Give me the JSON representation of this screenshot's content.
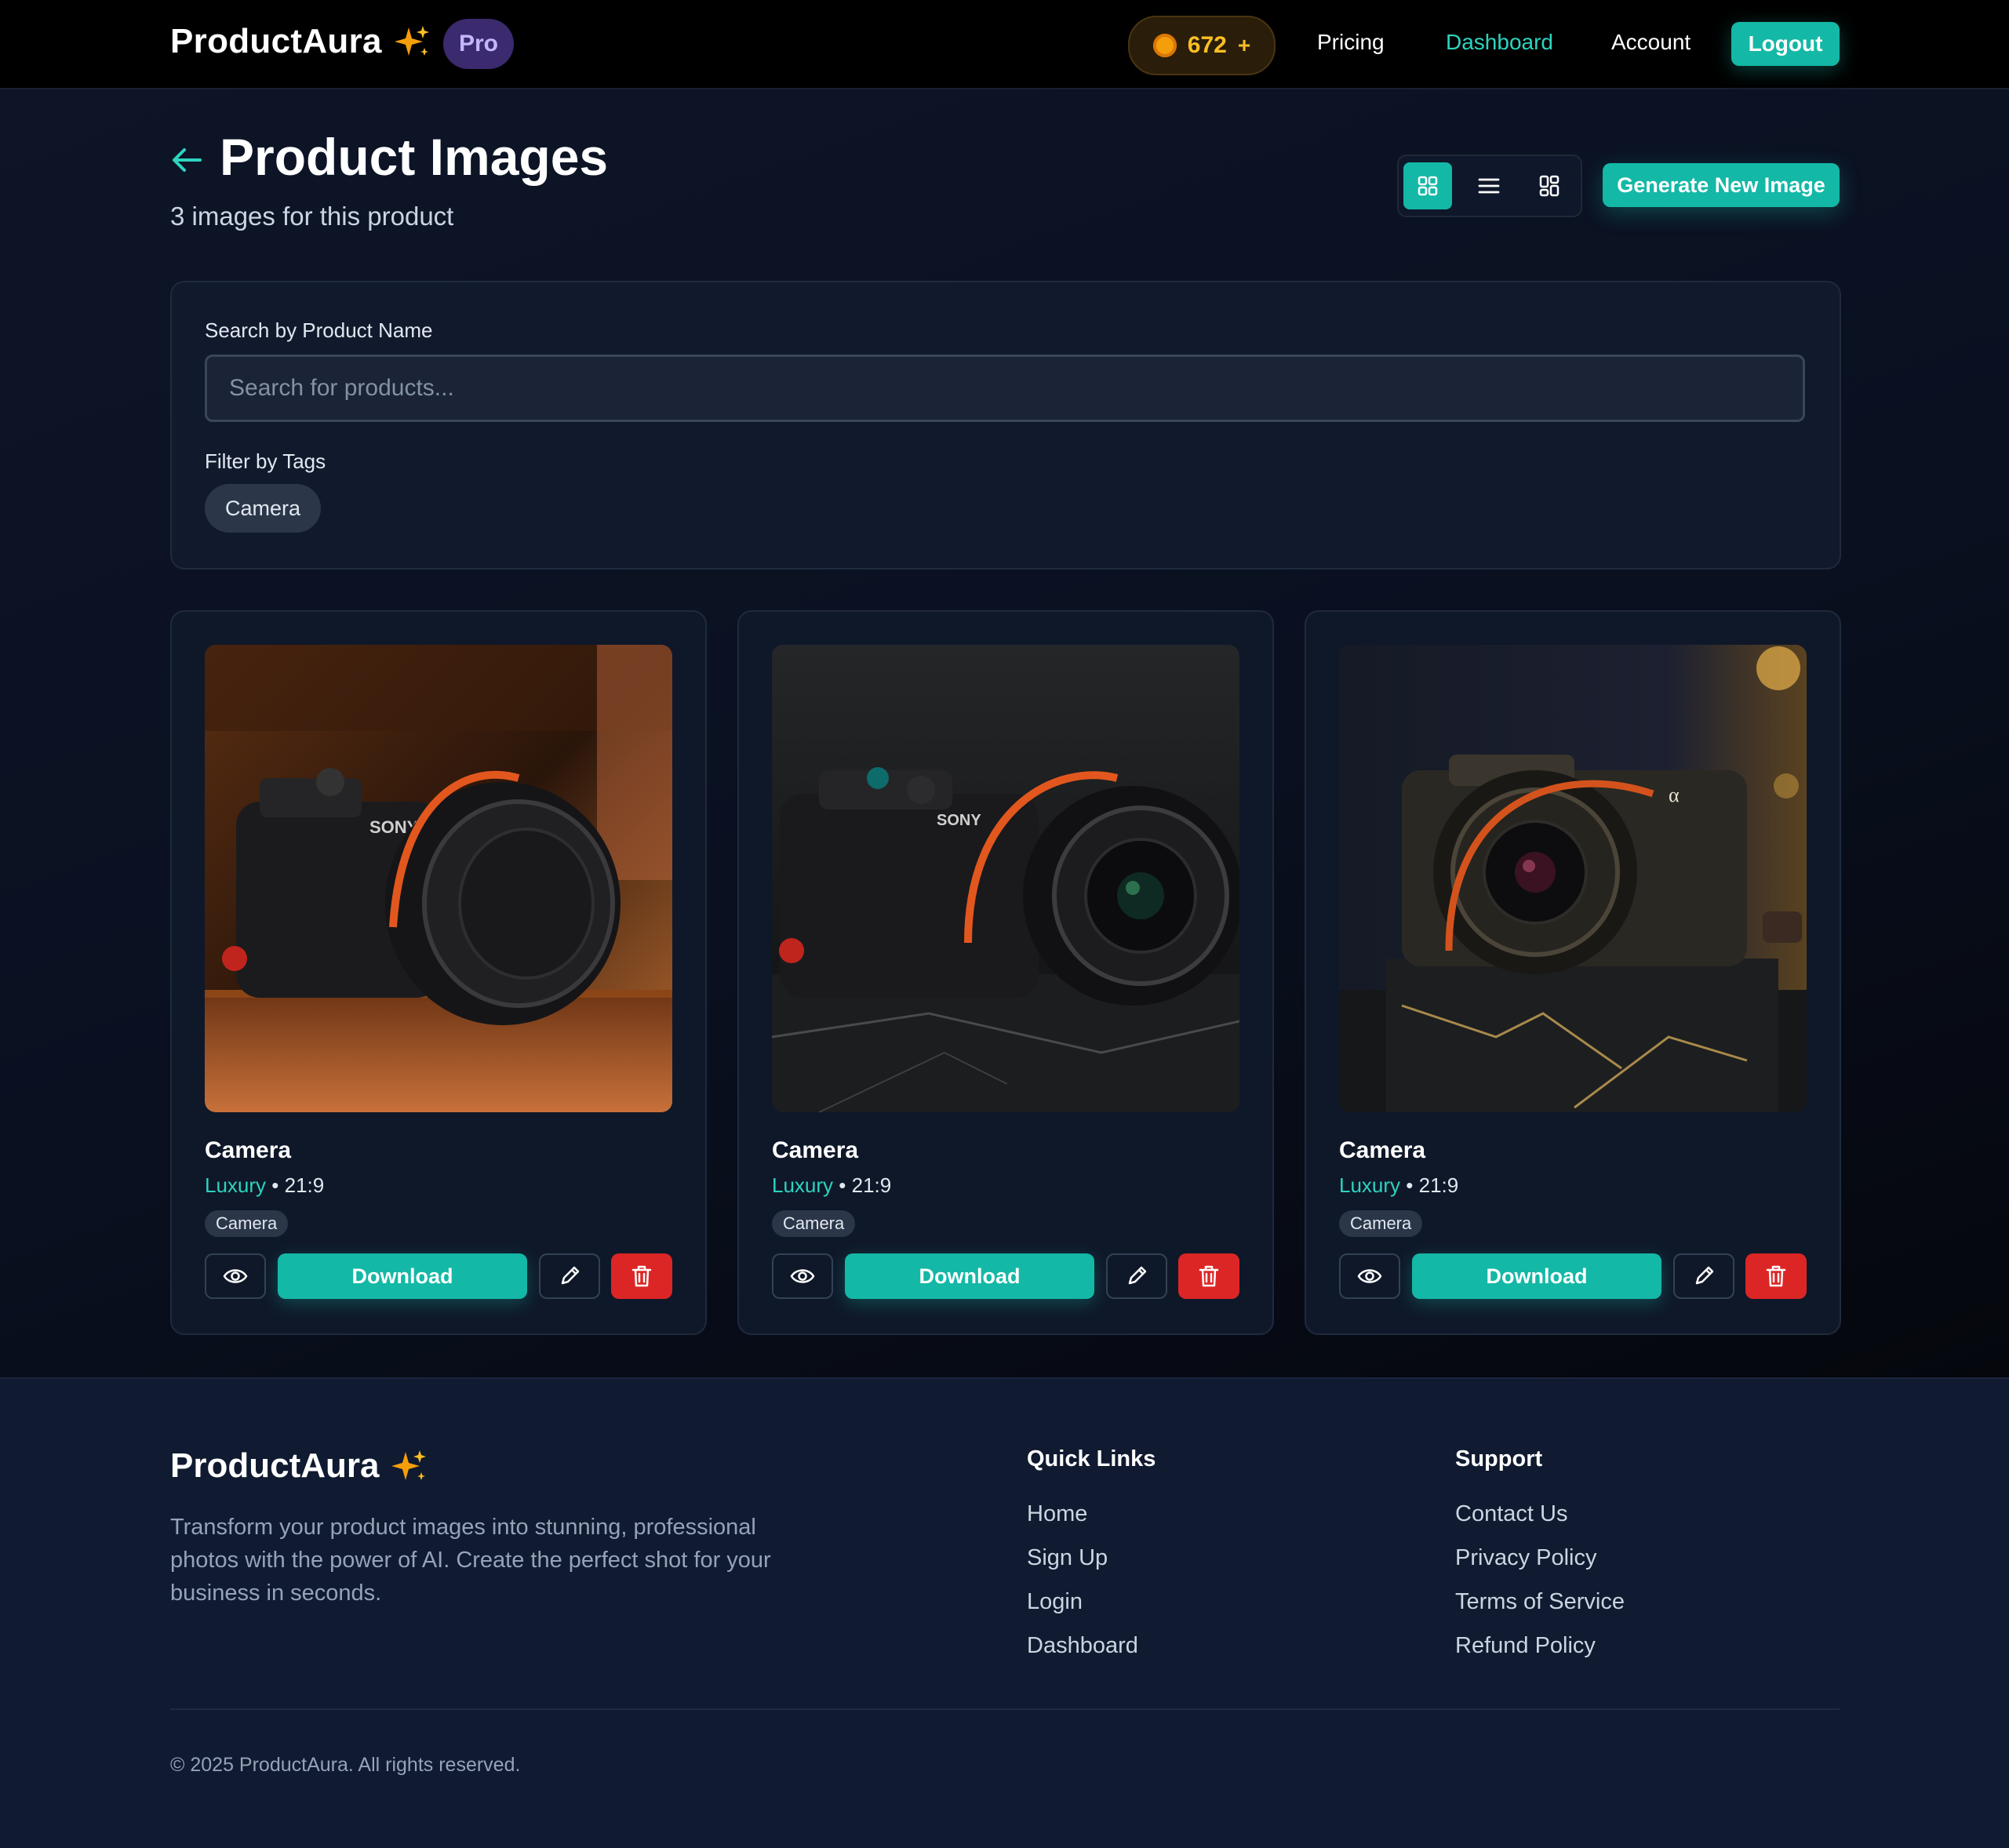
{
  "nav": {
    "brand": "ProductAura",
    "plan_badge": "Pro",
    "credits": "672",
    "credits_plus": "+",
    "links": [
      "Pricing",
      "Dashboard",
      "Account"
    ],
    "active_link": "Dashboard",
    "logout_label": "Logout",
    "icons": {
      "brand": "sparkles-icon",
      "credits": "coin-icon"
    }
  },
  "header": {
    "title": "Product Images",
    "subtitle": "3 images for this product",
    "view_modes": [
      "grid",
      "list",
      "masonry"
    ],
    "active_view": "grid",
    "generate_label": "Generate New Image"
  },
  "filter": {
    "search_label": "Search by Product Name",
    "search_placeholder": "Search for products...",
    "search_value": "",
    "tags_label": "Filter by Tags",
    "tags": [
      "Camera"
    ]
  },
  "cards": [
    {
      "title": "Camera",
      "style": "Luxury",
      "ratio": "21:9",
      "tag": "Camera",
      "download_label": "Download",
      "image": "camera-on-wooden-table"
    },
    {
      "title": "Camera",
      "style": "Luxury",
      "ratio": "21:9",
      "tag": "Camera",
      "download_label": "Download",
      "image": "camera-on-dark-marble"
    },
    {
      "title": "Camera",
      "style": "Luxury",
      "ratio": "21:9",
      "tag": "Camera",
      "download_label": "Download",
      "image": "camera-on-marble-pedestal"
    }
  ],
  "footer": {
    "brand": "ProductAura",
    "description": "Transform your product images into stunning, professional photos with the power of AI. Create the perfect shot for your business in seconds.",
    "quick_links_title": "Quick Links",
    "quick_links": [
      "Home",
      "Sign Up",
      "Login",
      "Dashboard"
    ],
    "support_title": "Support",
    "support_links": [
      "Contact Us",
      "Privacy Policy",
      "Terms of Service",
      "Refund Policy"
    ],
    "copyright": "© 2025 ProductAura. All rights reserved."
  },
  "colors": {
    "accent": "#14b8a6",
    "accent_text": "#2dd4bf",
    "danger": "#dc2626",
    "background": "#0b1120",
    "credits": "#fbbf24"
  }
}
